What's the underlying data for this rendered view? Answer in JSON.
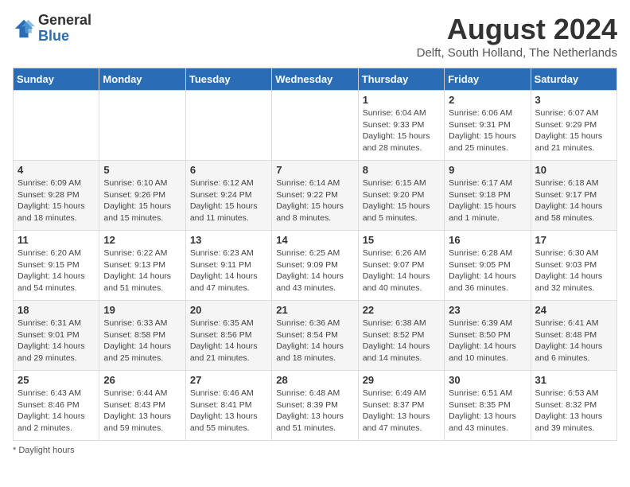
{
  "header": {
    "logo_general": "General",
    "logo_blue": "Blue",
    "month_title": "August 2024",
    "subtitle": "Delft, South Holland, The Netherlands"
  },
  "days_of_week": [
    "Sunday",
    "Monday",
    "Tuesday",
    "Wednesday",
    "Thursday",
    "Friday",
    "Saturday"
  ],
  "weeks": [
    [
      {
        "day": "",
        "content": ""
      },
      {
        "day": "",
        "content": ""
      },
      {
        "day": "",
        "content": ""
      },
      {
        "day": "",
        "content": ""
      },
      {
        "day": "1",
        "content": "Sunrise: 6:04 AM\nSunset: 9:33 PM\nDaylight: 15 hours and 28 minutes."
      },
      {
        "day": "2",
        "content": "Sunrise: 6:06 AM\nSunset: 9:31 PM\nDaylight: 15 hours and 25 minutes."
      },
      {
        "day": "3",
        "content": "Sunrise: 6:07 AM\nSunset: 9:29 PM\nDaylight: 15 hours and 21 minutes."
      }
    ],
    [
      {
        "day": "4",
        "content": "Sunrise: 6:09 AM\nSunset: 9:28 PM\nDaylight: 15 hours and 18 minutes."
      },
      {
        "day": "5",
        "content": "Sunrise: 6:10 AM\nSunset: 9:26 PM\nDaylight: 15 hours and 15 minutes."
      },
      {
        "day": "6",
        "content": "Sunrise: 6:12 AM\nSunset: 9:24 PM\nDaylight: 15 hours and 11 minutes."
      },
      {
        "day": "7",
        "content": "Sunrise: 6:14 AM\nSunset: 9:22 PM\nDaylight: 15 hours and 8 minutes."
      },
      {
        "day": "8",
        "content": "Sunrise: 6:15 AM\nSunset: 9:20 PM\nDaylight: 15 hours and 5 minutes."
      },
      {
        "day": "9",
        "content": "Sunrise: 6:17 AM\nSunset: 9:18 PM\nDaylight: 15 hours and 1 minute."
      },
      {
        "day": "10",
        "content": "Sunrise: 6:18 AM\nSunset: 9:17 PM\nDaylight: 14 hours and 58 minutes."
      }
    ],
    [
      {
        "day": "11",
        "content": "Sunrise: 6:20 AM\nSunset: 9:15 PM\nDaylight: 14 hours and 54 minutes."
      },
      {
        "day": "12",
        "content": "Sunrise: 6:22 AM\nSunset: 9:13 PM\nDaylight: 14 hours and 51 minutes."
      },
      {
        "day": "13",
        "content": "Sunrise: 6:23 AM\nSunset: 9:11 PM\nDaylight: 14 hours and 47 minutes."
      },
      {
        "day": "14",
        "content": "Sunrise: 6:25 AM\nSunset: 9:09 PM\nDaylight: 14 hours and 43 minutes."
      },
      {
        "day": "15",
        "content": "Sunrise: 6:26 AM\nSunset: 9:07 PM\nDaylight: 14 hours and 40 minutes."
      },
      {
        "day": "16",
        "content": "Sunrise: 6:28 AM\nSunset: 9:05 PM\nDaylight: 14 hours and 36 minutes."
      },
      {
        "day": "17",
        "content": "Sunrise: 6:30 AM\nSunset: 9:03 PM\nDaylight: 14 hours and 32 minutes."
      }
    ],
    [
      {
        "day": "18",
        "content": "Sunrise: 6:31 AM\nSunset: 9:01 PM\nDaylight: 14 hours and 29 minutes."
      },
      {
        "day": "19",
        "content": "Sunrise: 6:33 AM\nSunset: 8:58 PM\nDaylight: 14 hours and 25 minutes."
      },
      {
        "day": "20",
        "content": "Sunrise: 6:35 AM\nSunset: 8:56 PM\nDaylight: 14 hours and 21 minutes."
      },
      {
        "day": "21",
        "content": "Sunrise: 6:36 AM\nSunset: 8:54 PM\nDaylight: 14 hours and 18 minutes."
      },
      {
        "day": "22",
        "content": "Sunrise: 6:38 AM\nSunset: 8:52 PM\nDaylight: 14 hours and 14 minutes."
      },
      {
        "day": "23",
        "content": "Sunrise: 6:39 AM\nSunset: 8:50 PM\nDaylight: 14 hours and 10 minutes."
      },
      {
        "day": "24",
        "content": "Sunrise: 6:41 AM\nSunset: 8:48 PM\nDaylight: 14 hours and 6 minutes."
      }
    ],
    [
      {
        "day": "25",
        "content": "Sunrise: 6:43 AM\nSunset: 8:46 PM\nDaylight: 14 hours and 2 minutes."
      },
      {
        "day": "26",
        "content": "Sunrise: 6:44 AM\nSunset: 8:43 PM\nDaylight: 13 hours and 59 minutes."
      },
      {
        "day": "27",
        "content": "Sunrise: 6:46 AM\nSunset: 8:41 PM\nDaylight: 13 hours and 55 minutes."
      },
      {
        "day": "28",
        "content": "Sunrise: 6:48 AM\nSunset: 8:39 PM\nDaylight: 13 hours and 51 minutes."
      },
      {
        "day": "29",
        "content": "Sunrise: 6:49 AM\nSunset: 8:37 PM\nDaylight: 13 hours and 47 minutes."
      },
      {
        "day": "30",
        "content": "Sunrise: 6:51 AM\nSunset: 8:35 PM\nDaylight: 13 hours and 43 minutes."
      },
      {
        "day": "31",
        "content": "Sunrise: 6:53 AM\nSunset: 8:32 PM\nDaylight: 13 hours and 39 minutes."
      }
    ]
  ],
  "footer": {
    "note": "Daylight hours"
  }
}
